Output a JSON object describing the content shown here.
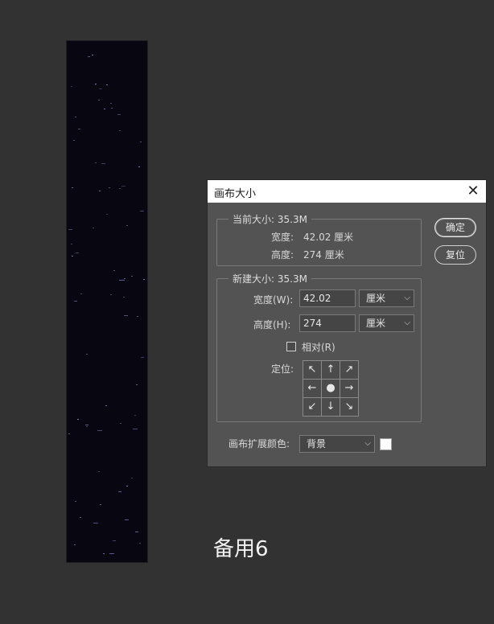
{
  "dialog": {
    "title": "画布大小",
    "current_size": {
      "legend": "当前大小: 35.3M",
      "width_label": "宽度:",
      "width_value": "42.02 厘米",
      "height_label": "高度:",
      "height_value": "274 厘米"
    },
    "new_size": {
      "legend": "新建大小: 35.3M",
      "width_label": "宽度(W):",
      "width_value": "42.02",
      "width_unit": "厘米",
      "height_label": "高度(H):",
      "height_value": "274",
      "height_unit": "厘米",
      "relative_label": "相对(R)",
      "relative_checked": false,
      "anchor_label": "定位:",
      "anchor_glyphs": [
        "↖",
        "↑",
        "↗",
        "←",
        "●",
        "→",
        "↙",
        "↓",
        "↘"
      ]
    },
    "extension_color": {
      "label": "画布扩展颜色:",
      "value": "背景",
      "swatch_color": "#ffffff"
    },
    "buttons": {
      "ok": "确定",
      "reset": "复位"
    }
  },
  "canvas_caption": "备用6",
  "colors": {
    "workspace": "#323232",
    "dialog_bg": "#535353",
    "canvas_bg": "#080711"
  }
}
